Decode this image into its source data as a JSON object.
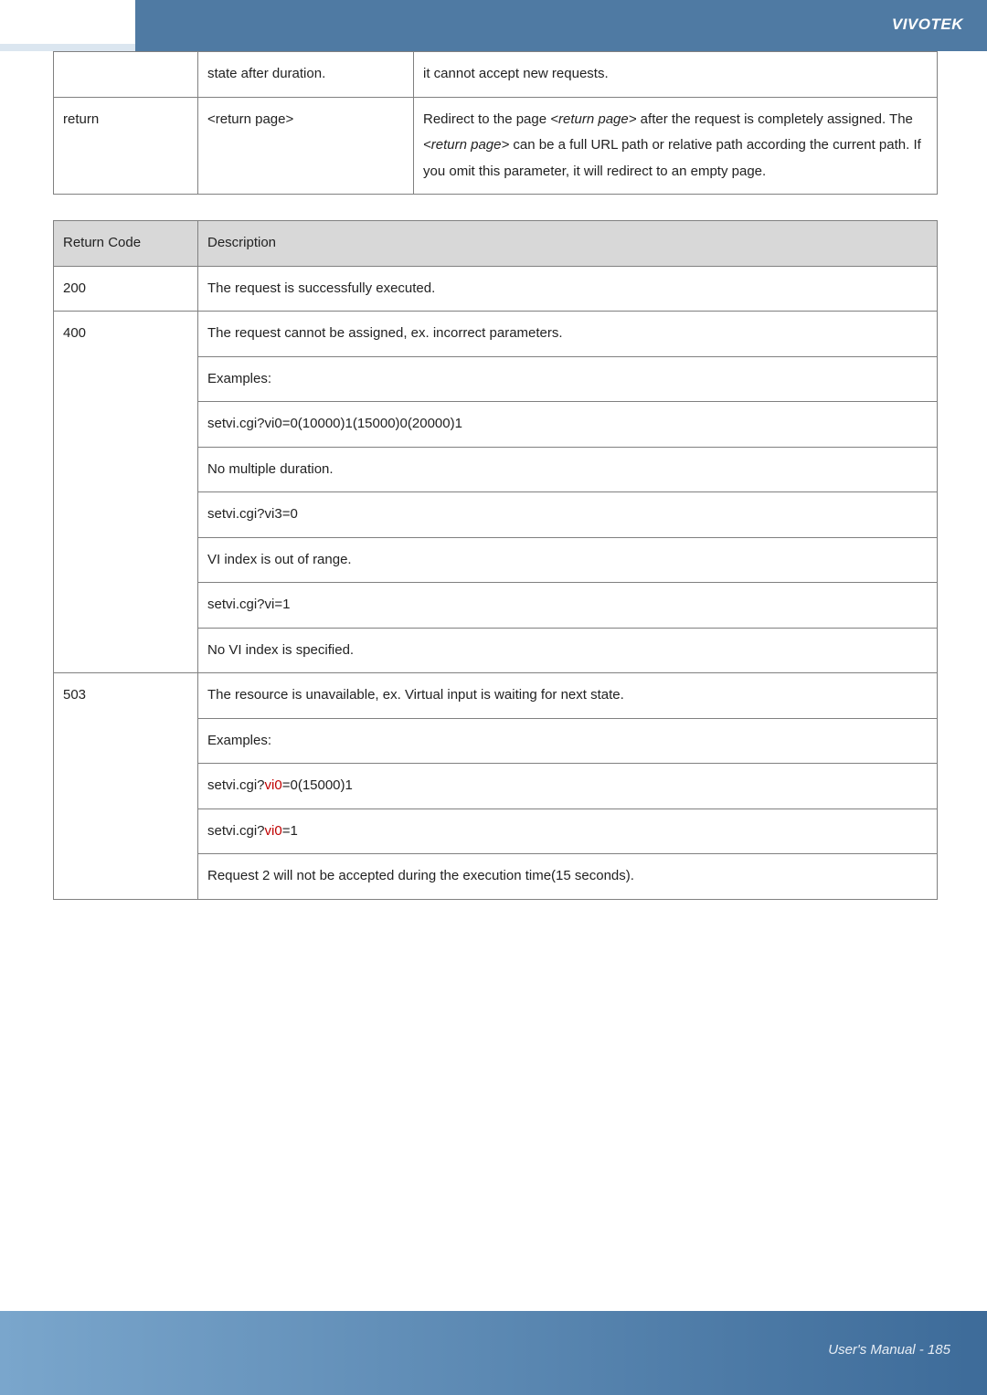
{
  "header": {
    "brand": "VIVOTEK"
  },
  "table1": {
    "rows": [
      {
        "c1": "",
        "c2": "state after duration.",
        "c3": "it cannot accept new requests."
      },
      {
        "c1": "return",
        "c2": "<return page>",
        "c3_prefix": "Redirect to the page ",
        "c3_em1": "<return page>",
        "c3_mid1": " after the request is completely assigned. The ",
        "c3_em2": "<return page>",
        "c3_mid2": " can be a full URL path or relative path according the current path. If you omit this parameter, it will redirect to an empty page."
      }
    ]
  },
  "table2": {
    "head": {
      "c1": "Return Code",
      "c2": "Description"
    },
    "r200": {
      "code": "200",
      "desc": "The request is successfully executed."
    },
    "r400": {
      "code": "400",
      "l1": "The request cannot be assigned, ex. incorrect parameters.",
      "l2": "Examples:",
      "l3": "setvi.cgi?vi0=0(10000)1(15000)0(20000)1",
      "l4": "No multiple duration.",
      "l5": "setvi.cgi?vi3=0",
      "l6": "VI index is out of range.",
      "l7": "setvi.cgi?vi=1",
      "l8": "No VI index is specified."
    },
    "r503": {
      "code": "503",
      "l1": "The resource is unavailable, ex. Virtual input is waiting for next state.",
      "l2": "Examples:",
      "l3a": "setvi.cgi?",
      "l3b": "vi0",
      "l3c": "=0(15000)1",
      "l4a": "setvi.cgi?",
      "l4b": "vi0",
      "l4c": "=1",
      "l5": "Request 2 will not be accepted during the execution time(15 seconds)."
    }
  },
  "footer": {
    "text": "User's Manual - 185"
  }
}
